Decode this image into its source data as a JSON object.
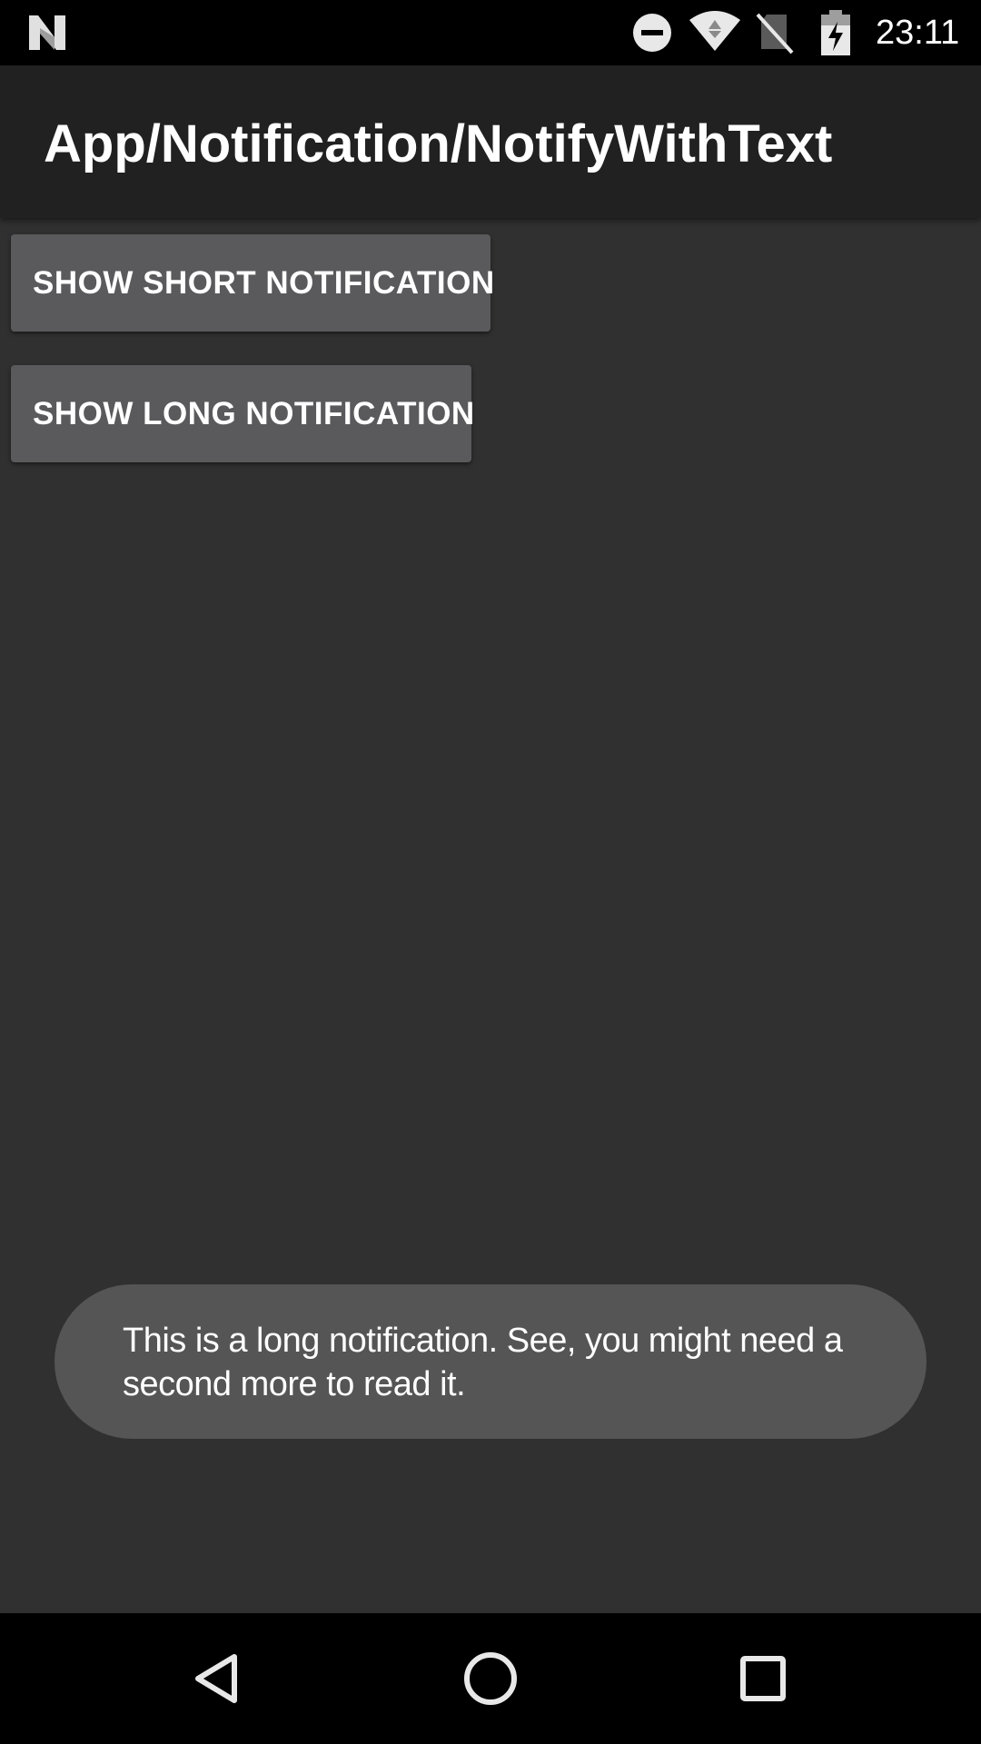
{
  "status_bar": {
    "time": "23:11",
    "icons": [
      "n-logo-icon",
      "dnd-icon",
      "wifi-icon",
      "no-sim-icon",
      "battery-charging-icon"
    ]
  },
  "app_bar": {
    "title": "App/Notification/NotifyWithText"
  },
  "buttons": {
    "short_label": "SHOW SHORT NOTIFICATION",
    "long_label": "SHOW LONG NOTIFICATION"
  },
  "toast": {
    "text": "This is a long notification. See, you might need a second more to read it."
  },
  "nav_bar": {
    "icons": [
      "back-icon",
      "home-icon",
      "recents-icon"
    ]
  },
  "colors": {
    "background": "#303030",
    "app_bar": "#212121",
    "button": "#5a5a5c",
    "toast": "#555555",
    "status_bar": "#000000"
  }
}
